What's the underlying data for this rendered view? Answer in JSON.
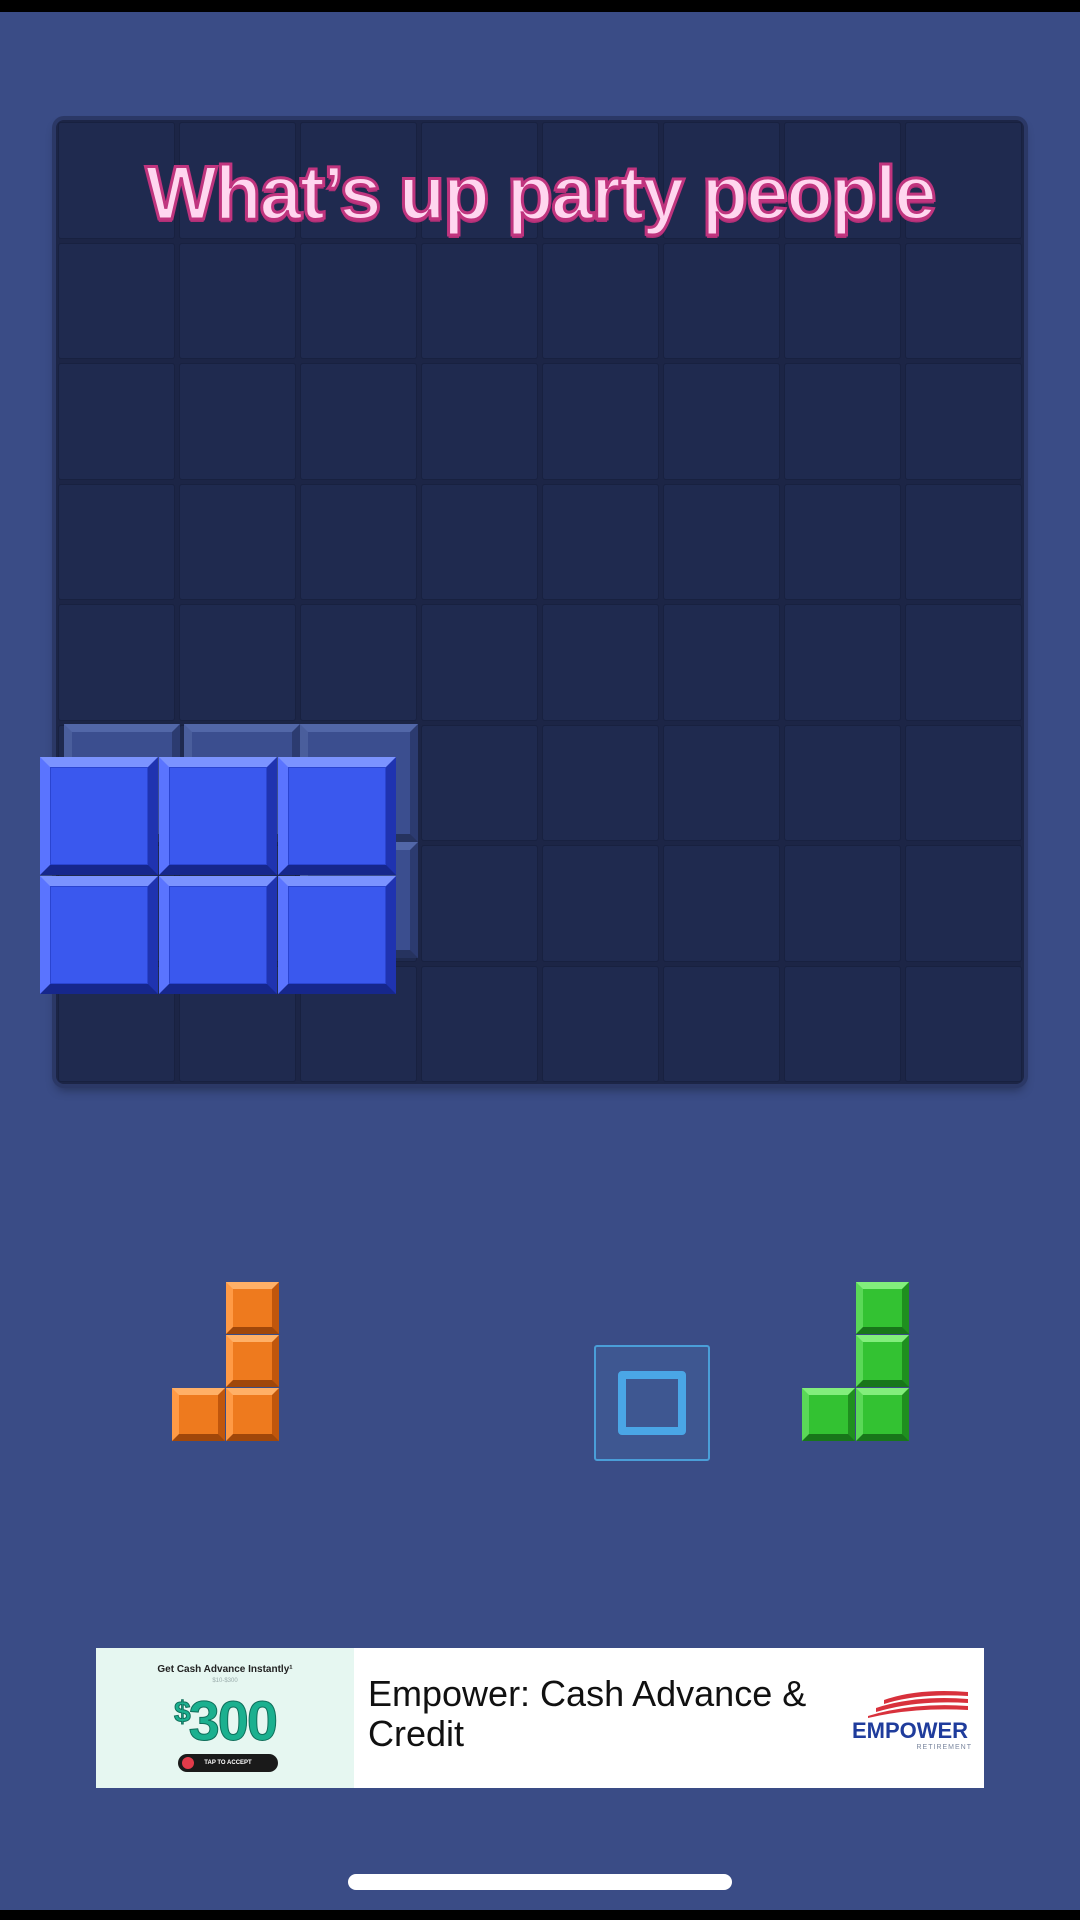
{
  "caption": "What’s up party people",
  "board": {
    "rows": 8,
    "cols": 8
  },
  "pieces_in_tray": [
    {
      "name": "orange-j-piece",
      "color": "#ee7a1e"
    },
    {
      "name": "empty-slot",
      "icon": "square-outline-icon"
    },
    {
      "name": "green-j-piece",
      "color": "#33c232"
    }
  ],
  "dragged_piece": {
    "shape": "2x3-rectangle",
    "color": "#3a58ee"
  },
  "ad": {
    "headline_small": "Get Cash Advance Instantly¹",
    "subline_small": "$10-$300",
    "amount_symbol": "$",
    "amount": "300",
    "tap_label": "TAP TO ACCEPT",
    "title": "Empower: Cash Advance & Credit",
    "brand": "EMPOWER",
    "brand_sub": "RETIREMENT"
  },
  "colors": {
    "background": "#3a4c86",
    "board": "#1c2546",
    "caption_fill": "#ffd6ef",
    "caption_stroke": "#c0347e"
  }
}
